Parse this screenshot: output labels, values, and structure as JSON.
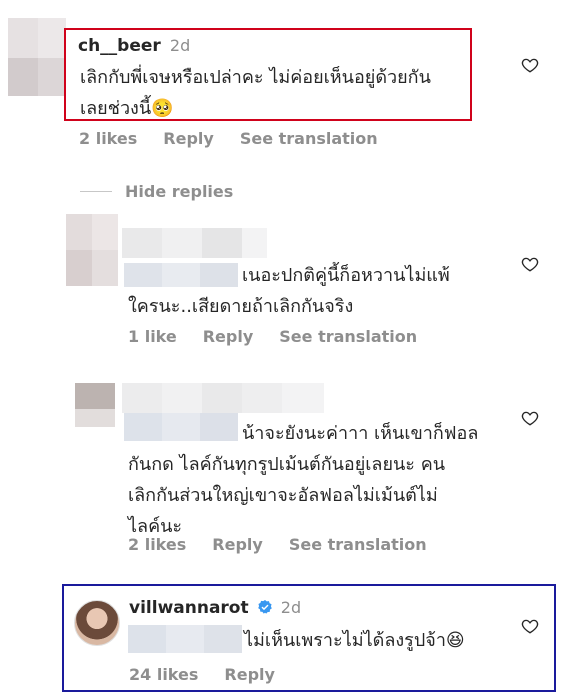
{
  "comments": [
    {
      "username": "ch__beer",
      "time": "2d",
      "text_lines": [
        "เลิกกับพี่เจษหรือเปล่าคะ ไม่ค่อยเห็นอยู่ด้วยกัน",
        "เลยช่วงนี้🥺"
      ],
      "likes": "2 likes",
      "reply": "Reply",
      "see_translation": "See translation"
    },
    {
      "text_lines": [
        "เนอะปกติคู่นี้ก็อหวานไม่แพ้",
        "ใครนะ..เสียดายถ้าเลิกกันจริง"
      ],
      "likes": "1 like",
      "reply": "Reply",
      "see_translation": "See translation"
    },
    {
      "text_lines": [
        "น้าจะยังนะค่าาา เห็นเขาก็ฟอล",
        "กันกด ไลค์กันทุกรูปเม้นต์กันอยู่เลยนะ คน",
        "เลิกกันส่วนใหญ่เขาจะอัลฟอลไม่เม้นต์ไม่",
        "ไลค์นะ"
      ],
      "likes": "2 likes",
      "reply": "Reply",
      "see_translation": "See translation"
    },
    {
      "username": "villwannarot",
      "verified": true,
      "time": "2d",
      "text_lines": [
        "ไม่เห็นเพราะไม่ได้ลงรูปจ้า😆"
      ],
      "likes": "24 likes",
      "reply": "Reply"
    }
  ],
  "hide_replies": "Hide replies",
  "colors": {
    "red_box": "#d0021b",
    "blue_box": "#1a1a9c",
    "verified": "#3897f0"
  }
}
